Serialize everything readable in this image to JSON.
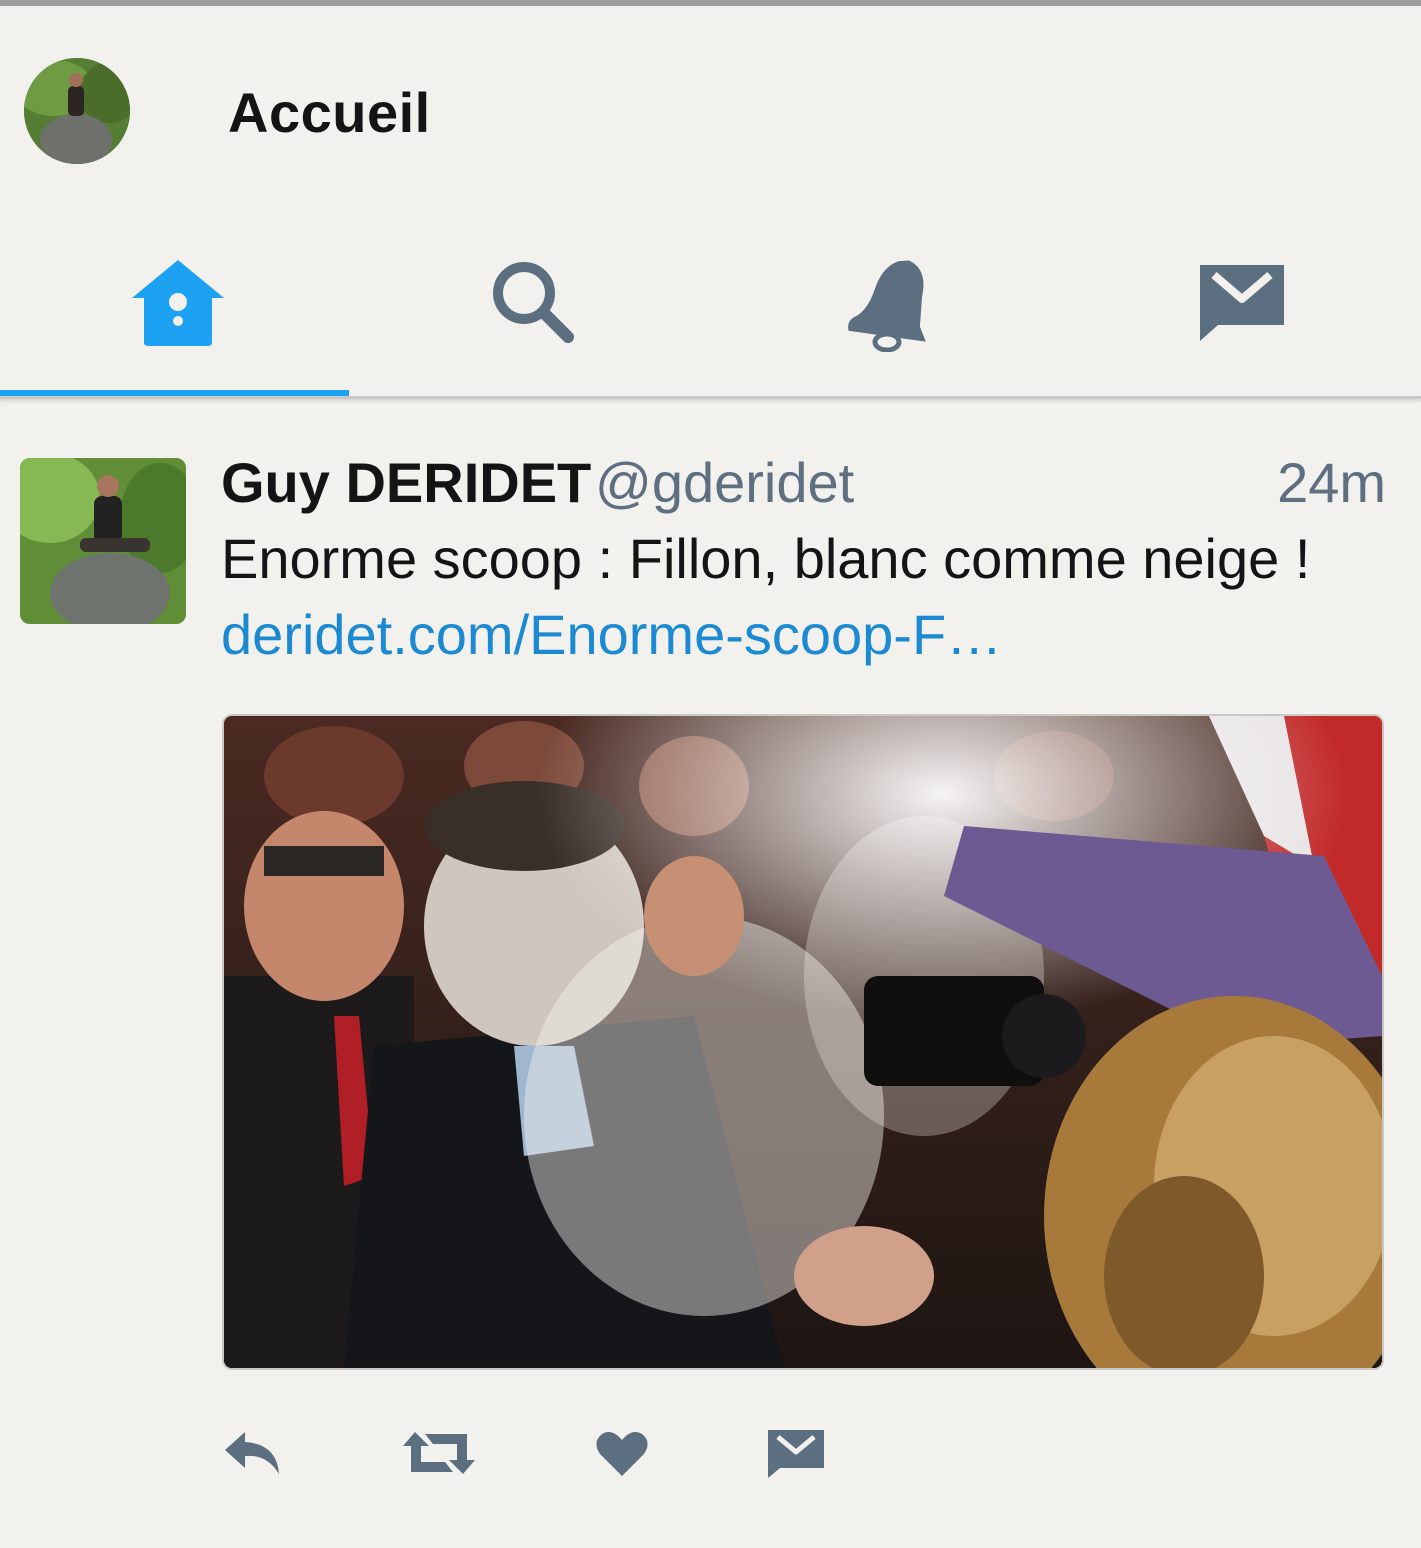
{
  "header": {
    "title": "Accueil",
    "avatar_icon": "profile-avatar"
  },
  "nav": {
    "active_color": "#1da1f2",
    "inactive_color": "#5c6f80",
    "tabs": [
      {
        "icon": "home-icon",
        "active": true
      },
      {
        "icon": "search-icon",
        "active": false
      },
      {
        "icon": "bell-icon",
        "active": false
      },
      {
        "icon": "mail-icon",
        "active": false
      }
    ]
  },
  "tweet": {
    "name": "Guy DERIDET",
    "handle": "@gderidet",
    "time": "24m",
    "text": "Enorme scoop : Fillon, blanc comme neige !",
    "link": "deridet.com/Enorme-scoop-F…",
    "link_color": "#1b8ad3",
    "actions": [
      {
        "icon": "reply-icon"
      },
      {
        "icon": "retweet-icon"
      },
      {
        "icon": "like-icon"
      },
      {
        "icon": "direct-message-icon"
      }
    ]
  }
}
